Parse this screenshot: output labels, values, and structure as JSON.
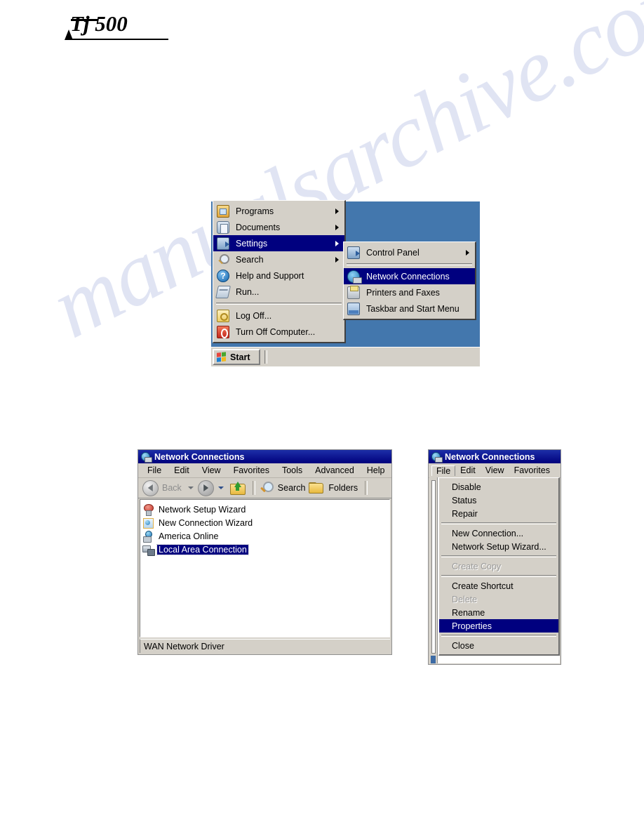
{
  "document": {
    "logo_text": "Tj 500"
  },
  "watermark": {
    "text": "manualsarchive.com"
  },
  "figure_start_menu": {
    "start_button_label": "Start",
    "start_menu_items": [
      {
        "label": "Programs",
        "icon": "programs-icon",
        "has_submenu": true,
        "selected": false
      },
      {
        "label": "Documents",
        "icon": "documents-icon",
        "has_submenu": true,
        "selected": false
      },
      {
        "label": "Settings",
        "icon": "settings-icon",
        "has_submenu": true,
        "selected": true
      },
      {
        "label": "Search",
        "icon": "search-icon",
        "has_submenu": true,
        "selected": false
      },
      {
        "label": "Help and Support",
        "icon": "help-icon",
        "has_submenu": false,
        "selected": false
      },
      {
        "label": "Run...",
        "icon": "run-icon",
        "has_submenu": false,
        "selected": false
      },
      {
        "label": "Log Off...",
        "icon": "logoff-icon",
        "has_submenu": false,
        "selected": false
      },
      {
        "label": "Turn Off Computer...",
        "icon": "shutdown-icon",
        "has_submenu": false,
        "selected": false
      }
    ],
    "settings_submenu_items": [
      {
        "label": "Control Panel",
        "icon": "control-panel-icon",
        "has_submenu": true,
        "selected": false
      },
      {
        "label": "Network Connections",
        "icon": "network-connections-icon",
        "has_submenu": false,
        "selected": true
      },
      {
        "label": "Printers and Faxes",
        "icon": "printer-icon",
        "has_submenu": false,
        "selected": false
      },
      {
        "label": "Taskbar and Start Menu",
        "icon": "taskbar-icon",
        "has_submenu": false,
        "selected": false
      }
    ]
  },
  "figure_network_connections": {
    "title": "Network Connections",
    "menu_bar": [
      "File",
      "Edit",
      "View",
      "Favorites",
      "Tools",
      "Advanced",
      "Help"
    ],
    "toolbar": {
      "back_label": "Back",
      "search_label": "Search",
      "folders_label": "Folders"
    },
    "connections": [
      {
        "label": "Network Setup Wizard",
        "icon": "network-setup-wizard-icon",
        "selected": false
      },
      {
        "label": "New Connection Wizard",
        "icon": "new-connection-wizard-icon",
        "selected": false
      },
      {
        "label": "America Online",
        "icon": "america-online-icon",
        "selected": false
      },
      {
        "label": "Local Area Connection",
        "icon": "local-area-connection-icon",
        "selected": true
      }
    ],
    "status_text": "WAN Network Driver"
  },
  "figure_file_menu": {
    "title": "Network Connections",
    "menu_bar": [
      "File",
      "Edit",
      "View",
      "Favorites"
    ],
    "active_menu": "File",
    "file_menu_items": [
      {
        "label": "Disable",
        "disabled": false,
        "selected": false
      },
      {
        "label": "Status",
        "disabled": false,
        "selected": false
      },
      {
        "label": "Repair",
        "disabled": false,
        "selected": false
      },
      {
        "separator": true
      },
      {
        "label": "New Connection...",
        "disabled": false,
        "selected": false
      },
      {
        "label": "Network Setup Wizard...",
        "disabled": false,
        "selected": false
      },
      {
        "separator": true
      },
      {
        "label": "Create Copy",
        "disabled": true,
        "selected": false
      },
      {
        "separator": true
      },
      {
        "label": "Create Shortcut",
        "disabled": false,
        "selected": false
      },
      {
        "label": "Delete",
        "disabled": true,
        "selected": false
      },
      {
        "label": "Rename",
        "disabled": false,
        "selected": false
      },
      {
        "label": "Properties",
        "disabled": false,
        "selected": true
      },
      {
        "separator": true
      },
      {
        "label": "Close",
        "disabled": false,
        "selected": false
      }
    ]
  },
  "colors": {
    "desktop_blue": "#4377ad",
    "titlebar_blue": "#00007c",
    "selection_blue": "#00007f",
    "window_face": "#d4d0c8",
    "watermark_blue": "#9aa7d8"
  }
}
